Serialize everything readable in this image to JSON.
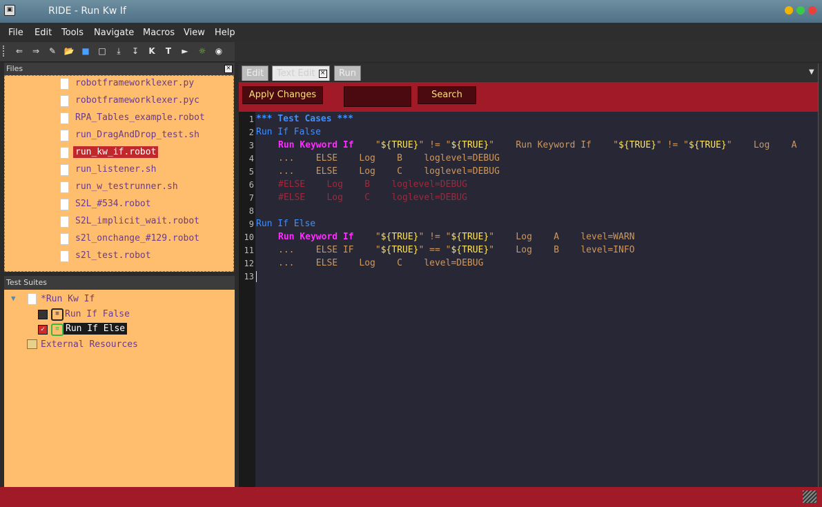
{
  "window": {
    "title": "RIDE - Run Kw If"
  },
  "menu": [
    "File",
    "Edit",
    "Tools",
    "Navigate",
    "Macros",
    "View",
    "Help"
  ],
  "toolbar": {
    "k_label": "K",
    "t_label": "T"
  },
  "files_panel": {
    "title": "Files",
    "items": [
      "robotframeworklexer.py",
      "robotframeworklexer.pyc",
      "RPA_Tables_example.robot",
      "run_DragAndDrop_test.sh",
      "run_kw_if.robot",
      "run_listener.sh",
      "run_w_testrunner.sh",
      "S2L_#534.robot",
      "S2L_implicit_wait.robot",
      "s2l_onchange_#129.robot",
      "s2l_test.robot"
    ],
    "selected": "run_kw_if.robot"
  },
  "suites_panel": {
    "title": "Test Suites",
    "root": "*Run Kw If",
    "tests": [
      "Run If False",
      "Run If Else"
    ],
    "external": "External Resources"
  },
  "tabs": [
    "Edit",
    "Text Edit",
    "Run"
  ],
  "actions": {
    "apply": "Apply Changes",
    "search": "Search",
    "search_value": ""
  },
  "line_numbers": [
    "1",
    "2",
    "3",
    "4",
    "5",
    "6",
    "7",
    "8",
    "9",
    "10",
    "11",
    "12",
    "13"
  ],
  "code": {
    "l1": "*** Test Cases ***",
    "l2": "Run If False",
    "l3_kw": "Run Keyword If",
    "l3_a": "    \"",
    "l3_v1": "${TRUE}",
    "l3_b": "\" != \"",
    "l3_v2": "${TRUE}",
    "l3_c": "\"    Run Keyword If    \"",
    "l3_v3": "${TRUE}",
    "l3_d": "\" != \"",
    "l3_v4": "${TRUE}",
    "l3_e": "\"    Log    A",
    "l4": "...    ELSE    Log    B    loglevel=DEBUG",
    "l5": "...    ELSE    Log    C    loglevel=DEBUG",
    "l6": "#ELSE    Log    B    loglevel=DEBUG",
    "l7": "#ELSE    Log    C    loglevel=DEBUG",
    "l9": "Run If Else",
    "l10_kw": "Run Keyword If",
    "l10_a": "    \"",
    "l10_v1": "${TRUE}",
    "l10_b": "\" != \"",
    "l10_v2": "${TRUE}",
    "l10_c": "\"    Log    A    level=WARN",
    "l11_a": "...    ELSE IF    \"",
    "l11_v1": "${TRUE}",
    "l11_b": "\" == \"",
    "l11_v2": "${TRUE}",
    "l11_c": "\"    Log    B    level=INFO",
    "l12": "...    ELSE    Log    C    level=DEBUG"
  },
  "colors": {
    "accent": "#a01a28",
    "panel": "#ffbd6e",
    "editor_bg": "#272736",
    "keyword": "#ff2cff",
    "variable": "#ffe35a"
  }
}
